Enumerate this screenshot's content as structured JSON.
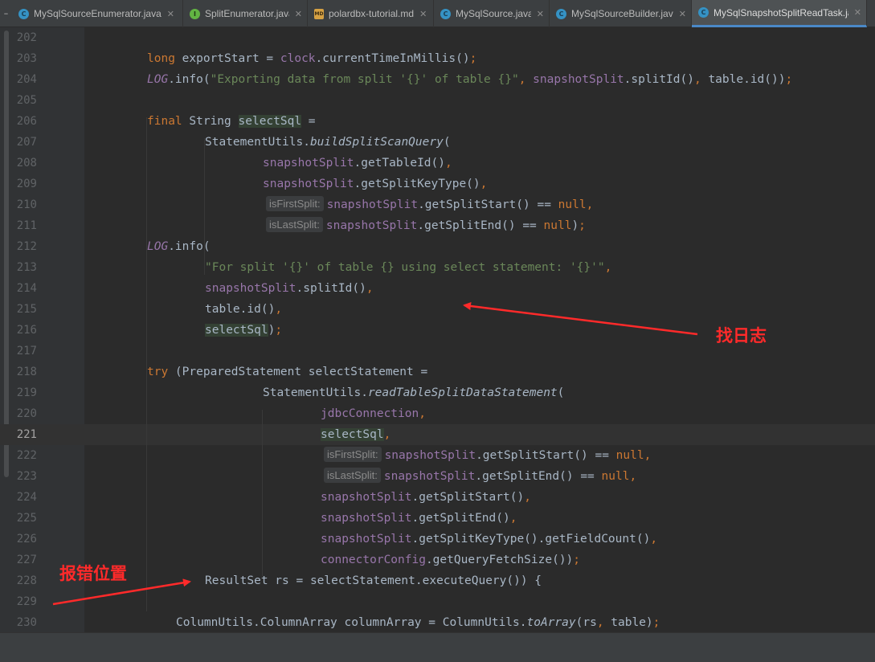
{
  "tabs": [
    {
      "label": "MySqlSourceEnumerator.java",
      "icon": "class",
      "active": false
    },
    {
      "label": "SplitEnumerator.java",
      "icon": "interface",
      "active": false
    },
    {
      "label": "polardbx-tutorial.md",
      "icon": "markdown",
      "active": false
    },
    {
      "label": "MySqlSource.java",
      "icon": "class",
      "active": false
    },
    {
      "label": "MySqlSourceBuilder.java",
      "icon": "class",
      "active": false
    },
    {
      "label": "MySqlSnapshotSplitReadTask.java",
      "icon": "class",
      "active": true
    }
  ],
  "editor": {
    "current_line": 221,
    "lines": [
      {
        "n": 202,
        "code": ""
      },
      {
        "n": 203,
        "code": "long exportStart = clock.currentTimeInMillis();"
      },
      {
        "n": 204,
        "code": "LOG.info(\"Exporting data from split '{}' of table {}\", snapshotSplit.splitId(), table.id());"
      },
      {
        "n": 205,
        "code": ""
      },
      {
        "n": 206,
        "code": "final String selectSql ="
      },
      {
        "n": 207,
        "code": "StatementUtils.buildSplitScanQuery("
      },
      {
        "n": 208,
        "code": "snapshotSplit.getTableId(),"
      },
      {
        "n": 209,
        "code": "snapshotSplit.getSplitKeyType(),"
      },
      {
        "n": 210,
        "hint": "isFirstSplit:",
        "code": "snapshotSplit.getSplitStart() == null,"
      },
      {
        "n": 211,
        "hint": "isLastSplit:",
        "code": "snapshotSplit.getSplitEnd() == null);"
      },
      {
        "n": 212,
        "code": "LOG.info("
      },
      {
        "n": 213,
        "code": "\"For split '{}' of table {} using select statement: '{}'\","
      },
      {
        "n": 214,
        "code": "snapshotSplit.splitId(),"
      },
      {
        "n": 215,
        "code": "table.id(),"
      },
      {
        "n": 216,
        "code": "selectSql);"
      },
      {
        "n": 217,
        "code": ""
      },
      {
        "n": 218,
        "code": "try (PreparedStatement selectStatement ="
      },
      {
        "n": 219,
        "code": "StatementUtils.readTableSplitDataStatement("
      },
      {
        "n": 220,
        "code": "jdbcConnection,"
      },
      {
        "n": 221,
        "code": "selectSql,"
      },
      {
        "n": 222,
        "hint": "isFirstSplit:",
        "code": "snapshotSplit.getSplitStart() == null,"
      },
      {
        "n": 223,
        "hint": "isLastSplit:",
        "code": "snapshotSplit.getSplitEnd() == null,"
      },
      {
        "n": 224,
        "code": "snapshotSplit.getSplitStart(),"
      },
      {
        "n": 225,
        "code": "snapshotSplit.getSplitEnd(),"
      },
      {
        "n": 226,
        "code": "snapshotSplit.getSplitKeyType().getFieldCount(),"
      },
      {
        "n": 227,
        "code": "connectorConfig.getQueryFetchSize());"
      },
      {
        "n": 228,
        "code": "ResultSet rs = selectStatement.executeQuery()) {"
      },
      {
        "n": 229,
        "code": ""
      },
      {
        "n": 230,
        "code": "ColumnUtils.ColumnArray columnArray = ColumnUtils.toArray(rs, table);"
      }
    ]
  },
  "annotations": {
    "find_log": "找日志",
    "error_location": "报错位置"
  },
  "colors": {
    "annotation": "#ff2a2a",
    "keyword": "#cc7832",
    "string": "#6a8759",
    "field": "#9876aa",
    "text": "#a9b7c6"
  }
}
